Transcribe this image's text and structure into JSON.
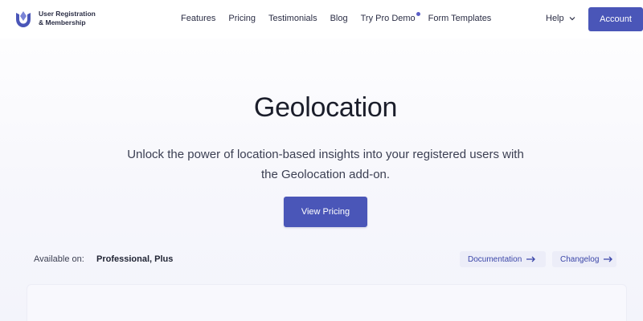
{
  "brand": {
    "line1": "User Registration",
    "line2": "& Membership",
    "logo_icon": "ur-logo-icon"
  },
  "nav": {
    "items": [
      {
        "label": "Features"
      },
      {
        "label": "Pricing"
      },
      {
        "label": "Testimonials"
      },
      {
        "label": "Blog"
      },
      {
        "label": "Try Pro Demo"
      },
      {
        "label": "Form Templates"
      }
    ],
    "help_label": "Help",
    "account_label": "Account"
  },
  "hero": {
    "title": "Geolocation",
    "subtitle": "Unlock the power of location-based insights into your registered users with the Geolocation add-on.",
    "cta_label": "View Pricing"
  },
  "availability": {
    "label": "Available on:",
    "value": "Professional, Plus"
  },
  "links": {
    "documentation": "Documentation",
    "changelog": "Changelog"
  },
  "colors": {
    "accent": "#4a56b8",
    "link": "#3b46a8",
    "chip_bg": "#ecedf8"
  }
}
